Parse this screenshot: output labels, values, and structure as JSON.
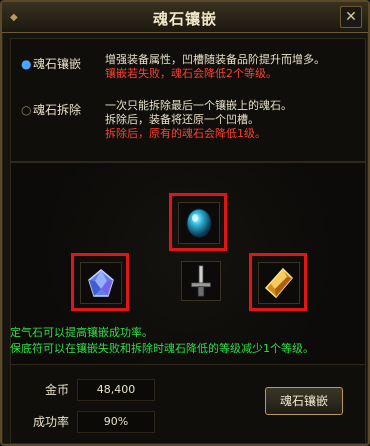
{
  "window": {
    "title": "魂石镶嵌",
    "close_label": "✕"
  },
  "options": [
    {
      "label": "魂石镶嵌",
      "description_lines": [
        "增强装备属性，凹槽随装备品阶提升而增多。"
      ],
      "warning_lines": [
        "镶嵌若失败，魂石会降低2个等级。"
      ]
    },
    {
      "label": "魂石拆除",
      "description_lines": [
        "一次只能拆除最后一个镶嵌上的魂石。",
        "拆除后，装备将还原一个凹槽。"
      ],
      "warning_lines": [
        "拆除后，原有的魂石会降低1级。"
      ]
    }
  ],
  "sockets": [
    {
      "name": "top-socket",
      "gem": "teal-orb-gem",
      "highlight": "#e01515"
    },
    {
      "name": "left-socket",
      "gem": "blue-crystal-gem",
      "highlight": "#e01515"
    },
    {
      "name": "center-slot",
      "gem": "sword-hilt-icon"
    },
    {
      "name": "right-socket",
      "gem": "gold-amber-gem",
      "highlight": "#e01515"
    }
  ],
  "notes": [
    "定气石可以提高镶嵌成功率。",
    "保底符可以在镶嵌失败和拆除时魂石降低的等级减少1个等级。"
  ],
  "stats": {
    "gold_label": "金币",
    "gold_value": "48,400",
    "rate_label": "成功率",
    "rate_value": "90%"
  },
  "action_button": "魂石镶嵌",
  "colors": {
    "accent_green": "#2fde4a",
    "warning_red": "#ff3f2e",
    "highlight_red": "#e01515",
    "gold_border": "#b89a5a"
  }
}
